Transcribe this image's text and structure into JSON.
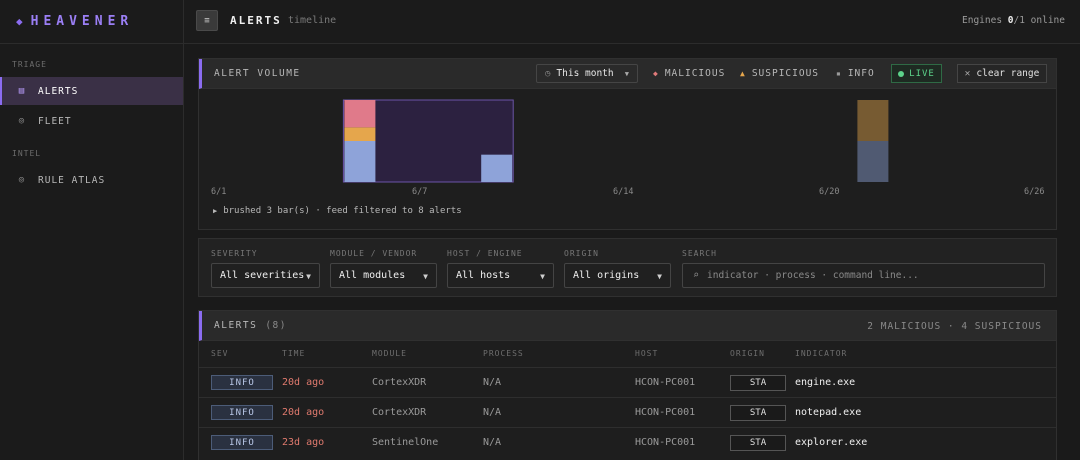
{
  "brand": {
    "name": "HEAVENER",
    "icon": "diamond-icon"
  },
  "nav": {
    "sections": [
      "TRIAGE",
      "INTEL"
    ],
    "items": [
      {
        "label": "ALERTS",
        "icon": "list-icon",
        "active": true
      },
      {
        "label": "FLEET",
        "icon": "target-icon",
        "active": false
      },
      {
        "label": "RULE ATLAS",
        "icon": "target-icon",
        "active": false
      }
    ]
  },
  "header": {
    "title": "ALERTS",
    "subtitle": "timeline",
    "engines_label": "Engines",
    "engines_online": "0",
    "engines_total": "/1 online"
  },
  "volume": {
    "title": "ALERT VOLUME",
    "range": "This month",
    "legend": [
      {
        "label": "MALICIOUS",
        "symbol": "◆",
        "color": "#e07a7a"
      },
      {
        "label": "SUSPICIOUS",
        "symbol": "▲",
        "color": "#e5a64c"
      },
      {
        "label": "INFO",
        "symbol": "▪",
        "color": "#9a9a9a"
      }
    ],
    "live_label": "LIVE",
    "clear_label": "clear range",
    "brush_note": "brushed 3 bar(s) · feed filtered to 8 alerts"
  },
  "chart_data": {
    "type": "bar",
    "stacked": true,
    "x_ticks": [
      "6/1",
      "6/7",
      "6/14",
      "6/20",
      "6/26"
    ],
    "days": [
      "6/1",
      "6/2",
      "6/3",
      "6/4",
      "6/5",
      "6/6",
      "6/7",
      "6/8",
      "6/9",
      "6/10",
      "6/11",
      "6/12",
      "6/13",
      "6/14",
      "6/15",
      "6/16",
      "6/17",
      "6/18",
      "6/19",
      "6/20",
      "6/21",
      "6/22",
      "6/23",
      "6/24",
      "6/25",
      "6/26"
    ],
    "series": [
      {
        "name": "INFO",
        "color": "#8ea3d9",
        "values": [
          0,
          0,
          3,
          0,
          0,
          0,
          2,
          0,
          0,
          0,
          0,
          0,
          0,
          0,
          0,
          0,
          0,
          3,
          0,
          0,
          0,
          0,
          0,
          0,
          0,
          0
        ]
      },
      {
        "name": "SUSPICIOUS",
        "color": "#e5a64c",
        "values": [
          0,
          0,
          1,
          0,
          0,
          0,
          0,
          0,
          0,
          0,
          0,
          0,
          0,
          0,
          0,
          0,
          0,
          3,
          0,
          0,
          0,
          0,
          0,
          0,
          0,
          0
        ]
      },
      {
        "name": "MALICIOUS",
        "color": "#e07a8a",
        "values": [
          0,
          0,
          2,
          0,
          0,
          0,
          0,
          0,
          0,
          0,
          0,
          0,
          0,
          0,
          0,
          0,
          0,
          0,
          0,
          0,
          0,
          0,
          0,
          0,
          0,
          0
        ]
      }
    ],
    "brushed_days": [
      "6/3",
      "6/5",
      "6/7"
    ],
    "ylim": [
      0,
      6
    ]
  },
  "filters": {
    "severity": {
      "label": "SEVERITY",
      "value": "All severities"
    },
    "module": {
      "label": "MODULE / VENDOR",
      "value": "All modules"
    },
    "host": {
      "label": "HOST / ENGINE",
      "value": "All hosts"
    },
    "origin": {
      "label": "ORIGIN",
      "value": "All origins"
    },
    "search": {
      "label": "SEARCH",
      "placeholder": "indicator · process · command line..."
    }
  },
  "alerts": {
    "title": "ALERTS",
    "count": "(8)",
    "summary": "2 MALICIOUS · 4 SUSPICIOUS",
    "columns": [
      "SEV",
      "TIME",
      "MODULE",
      "PROCESS",
      "HOST",
      "ORIGIN",
      "INDICATOR"
    ],
    "rows": [
      {
        "sev": "INFO",
        "time": "20d ago",
        "module": "CortexXDR",
        "process": "N/A",
        "host": "HCON-PC001",
        "origin": "STA",
        "indicator": "engine.exe"
      },
      {
        "sev": "INFO",
        "time": "20d ago",
        "module": "CortexXDR",
        "process": "N/A",
        "host": "HCON-PC001",
        "origin": "STA",
        "indicator": "notepad.exe"
      },
      {
        "sev": "INFO",
        "time": "23d ago",
        "module": "SentinelOne",
        "process": "N/A",
        "host": "HCON-PC001",
        "origin": "STA",
        "indicator": "explorer.exe"
      }
    ]
  }
}
